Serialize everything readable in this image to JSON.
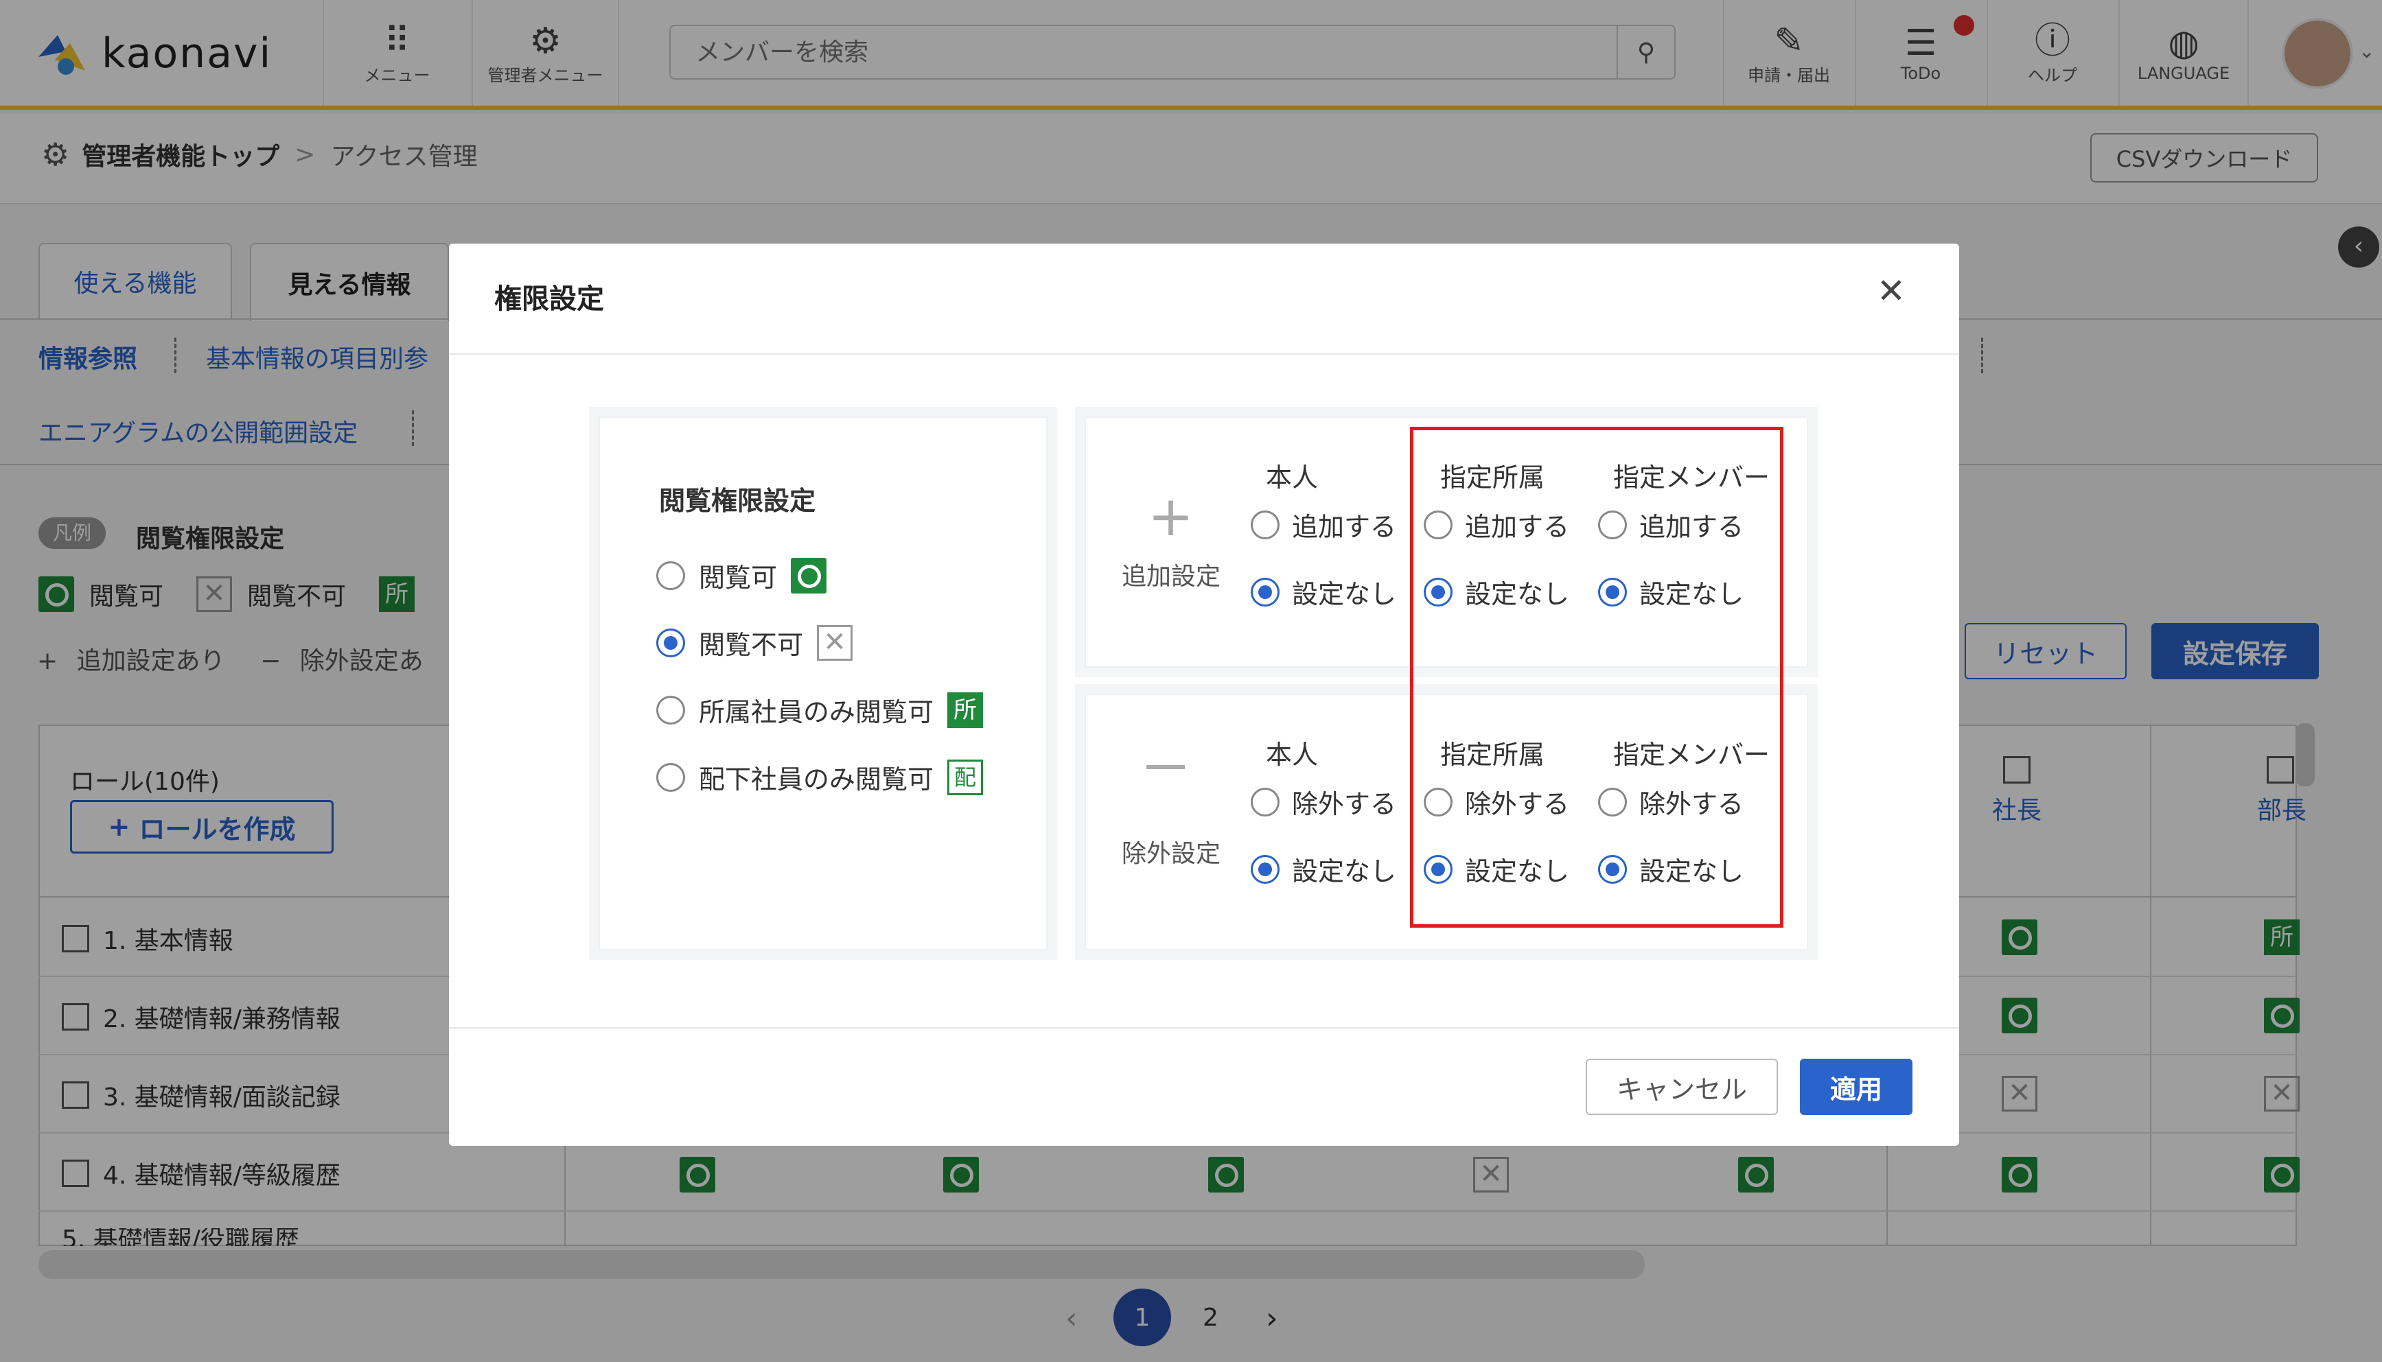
{
  "header": {
    "logo_text": "kaonavi",
    "menu_label": "メニュー",
    "admin_menu_label": "管理者メニュー",
    "search_placeholder": "メンバーを検索",
    "request_label": "申請・届出",
    "todo_label": "ToDo",
    "help_label": "ヘルプ",
    "language_label": "LANGUAGE"
  },
  "breadcrumb": {
    "root": "管理者機能トップ",
    "sep": ">",
    "current": "アクセス管理"
  },
  "csv_button": "CSVダウンロード",
  "tabs": [
    "使える機能",
    "見える情報"
  ],
  "subnav": [
    "情報参照",
    "基本情報の項目別参",
    "エニアグラムの公開範囲設定"
  ],
  "legend": {
    "tag": "凡例",
    "title": "閲覧権限設定",
    "items": [
      "閲覧可",
      "閲覧不可",
      "所"
    ],
    "add_note": "追加設定あり",
    "remove_note": "除外設定あ"
  },
  "actions": {
    "reset": "リセット",
    "save": "設定保存"
  },
  "table": {
    "role_header": "ロール(10件)",
    "create_role": "ロールを作成",
    "col_president": "社長",
    "col_manager": "部長",
    "rows": [
      "1. 基本情報",
      "2. 基礎情報/兼務情報",
      "3. 基礎情報/面談記録",
      "4. 基礎情報/等級履歴",
      "5. 基礎情報/役職履歴"
    ]
  },
  "pagination": {
    "pages": [
      "1",
      "2"
    ],
    "current": "1"
  },
  "modal": {
    "title": "権限設定",
    "view_permission": {
      "heading": "閲覧権限設定",
      "options": [
        "閲覧可",
        "閲覧不可",
        "所属社員のみ閲覧可",
        "配下社員のみ閲覧可"
      ],
      "selected": 1,
      "badge_affil": "所",
      "badge_sub": "配"
    },
    "add_setting": {
      "label": "追加設定",
      "columns": [
        "本人",
        "指定所属",
        "指定メンバー"
      ],
      "option_on": "追加する",
      "option_off": "設定なし"
    },
    "remove_setting": {
      "label": "除外設定",
      "columns": [
        "本人",
        "指定所属",
        "指定メンバー"
      ],
      "option_on": "除外する",
      "option_off": "設定なし"
    },
    "cancel": "キャンセル",
    "apply": "適用"
  },
  "colors": {
    "accent": "#2a63c9",
    "ok_green": "#1f8a3b",
    "highlight_red": "#e01b1b",
    "header_border": "#f2c230"
  }
}
